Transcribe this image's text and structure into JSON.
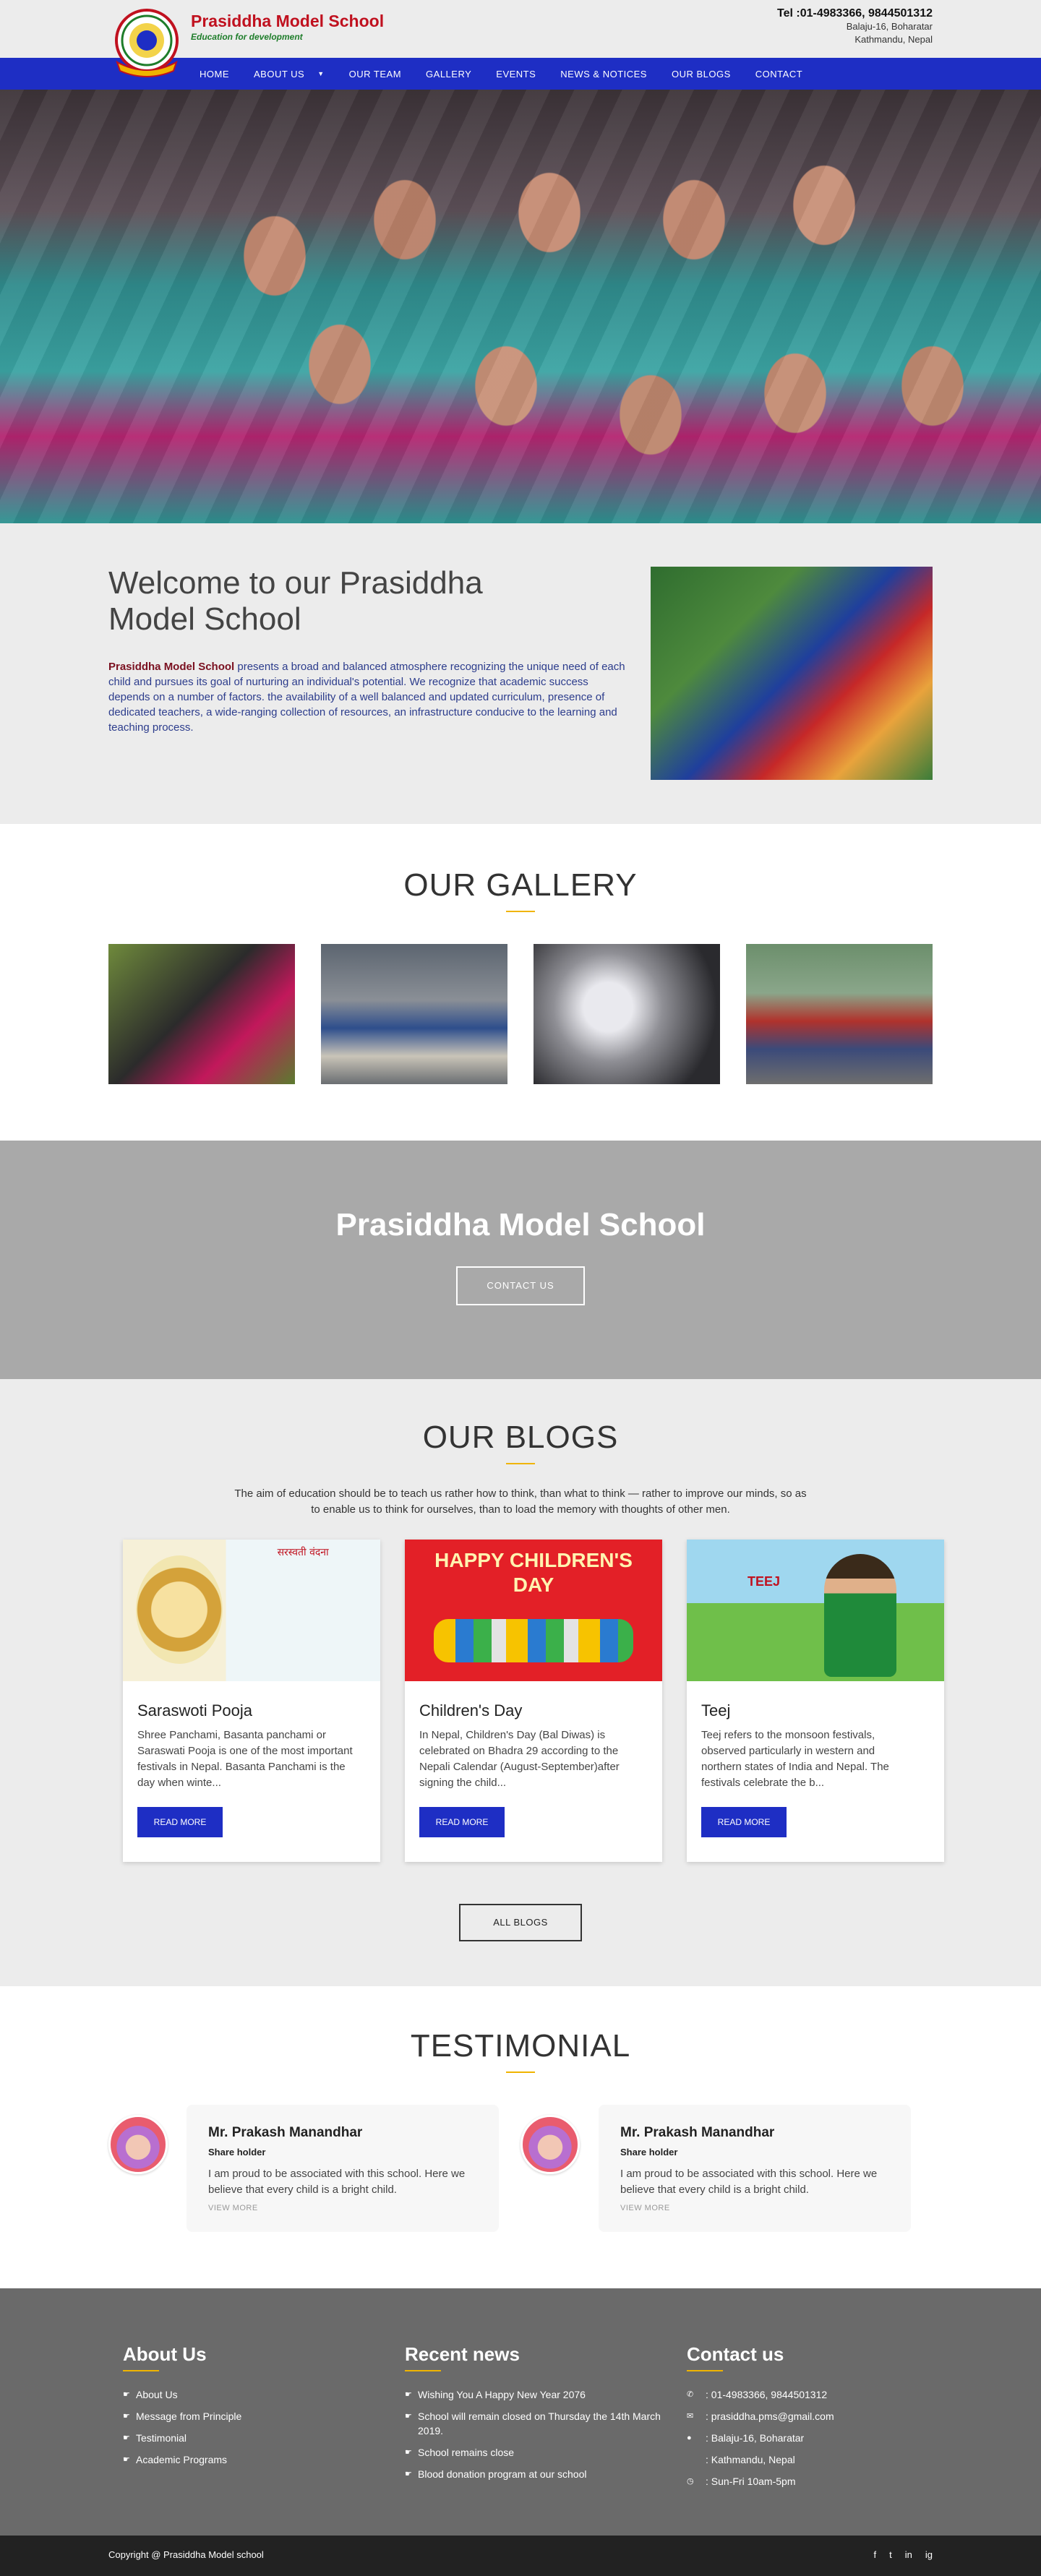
{
  "header": {
    "brand_name": "Prasiddha Model School",
    "tagline": "Education for development",
    "phone": "Tel :01-4983366, 9844501312",
    "address_line1": "Balaju-16, Boharatar",
    "address_line2": "Kathmandu, Nepal"
  },
  "nav": {
    "items": [
      "HOME",
      "ABOUT US",
      "OUR TEAM",
      "GALLERY",
      "EVENTS",
      "NEWS & NOTICES",
      "OUR BLOGS",
      "CONTACT"
    ],
    "caret": "▼"
  },
  "welcome": {
    "title_line1": "Welcome to our Prasiddha",
    "title_line2": "Model School",
    "school_name": "Prasiddha Model School",
    "text": " presents a broad and balanced atmosphere recognizing the unique need of each child and pursues its goal of nurturing an individual's potential. We recognize that academic success depends on a number of factors. the availability of a well balanced and updated curriculum, presence of dedicated teachers, a wide-ranging collection of resources, an infrastructure conducive to the learning and teaching process."
  },
  "gallery": {
    "title": "OUR GALLERY"
  },
  "cta": {
    "title": "Prasiddha Model School",
    "button": "CONTACT US"
  },
  "blogs": {
    "title": "OUR BLOGS",
    "lead": "The aim of education should be to teach us rather how to think, than what to think — rather to improve our minds, so as to enable us to think for ourselves, than to load the memory with thoughts of other men.",
    "cards": [
      {
        "title": "Saraswoti Pooja",
        "excerpt": "Shree Panchami, Basanta panchami or Saraswati Pooja is one of the most important festivals in Nepal. Basanta Panchami is the day when winte...",
        "button": "READ MORE",
        "image_header": "सरस्वती वंदना"
      },
      {
        "title": "Children's Day",
        "excerpt": "In Nepal, Children's Day (Bal Diwas) is celebrated on Bhadra 29 according to the Nepali Calendar (August-September)after signing the child...",
        "button": "READ MORE",
        "image_header": "HAPPY CHILDREN'S DAY"
      },
      {
        "title": "Teej",
        "excerpt": "Teej refers to the monsoon festivals, observed particularly in western and northern states of India and Nepal. The festivals celebrate the b...",
        "button": "READ MORE",
        "image_header": "TEEJ"
      }
    ],
    "all_button": "ALL BLOGS"
  },
  "testimonial": {
    "title": "TESTIMONIAL",
    "items": [
      {
        "name": "Mr. Prakash Manandhar",
        "role": "Share holder",
        "quote": "I am proud to be associated with this school. Here we believe that every child is a bright child.",
        "more": "VIEW MORE"
      },
      {
        "name": "Mr. Prakash Manandhar",
        "role": "Share holder",
        "quote": "I am proud to be associated with this school. Here we believe that every child is a bright child.",
        "more": "VIEW MORE"
      }
    ]
  },
  "footer": {
    "about_title": "About Us",
    "about_links": [
      "About Us",
      "Message from Principle",
      "Testimonial",
      "Academic Programs"
    ],
    "news_title": "Recent news",
    "news_links": [
      "Wishing You A Happy New Year 2076",
      "School will remain closed on Thursday the 14th March 2019.",
      "School remains close",
      "Blood donation program at our school"
    ],
    "contact_title": "Contact us",
    "contact_phone": ": 01-4983366, 9844501312",
    "contact_email": ": prasiddha.pms@gmail.com",
    "contact_addr1": ": Balaju-16, Boharatar",
    "contact_addr2": ": Kathmandu, Nepal",
    "contact_hours": ": Sun-Fri 10am-5pm",
    "copyright": "Copyright @ Prasiddha Model school",
    "social": [
      "f",
      "t",
      "in",
      "ig"
    ]
  },
  "colors": {
    "nav": "#1e2ec4",
    "brand_red": "#c0111f",
    "tagline_green": "#1e7d2a",
    "accent_underline": "#f0b400",
    "footer": "#6a6a6a"
  }
}
